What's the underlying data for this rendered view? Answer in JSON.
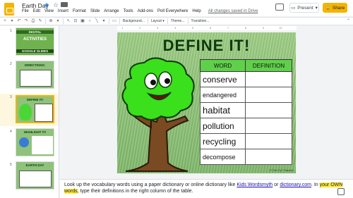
{
  "app": {
    "doc_title": "Earth Day",
    "globe_icon": "globe-icon",
    "saved_status": "All changes saved in Drive",
    "present_label": "Present",
    "share_label": "Share",
    "brand_color": "#f4b400"
  },
  "menu": [
    "File",
    "Edit",
    "View",
    "Insert",
    "Format",
    "Slide",
    "Arrange",
    "Tools",
    "Add-ons",
    "Poll Everywhere",
    "Help"
  ],
  "toolbar": {
    "background_label": "Background...",
    "layout_label": "Layout ▾",
    "theme_label": "Theme...",
    "transition_label": "Transition..."
  },
  "ruler": [
    "1",
    "2",
    "3",
    "4",
    "5",
    "6",
    "7",
    "8",
    "9",
    "10"
  ],
  "slides": [
    {
      "num": "1",
      "caption_1": "DIGITAL",
      "caption_2": "ACTIVITIES",
      "caption_3": "GOOGLE SLIDES"
    },
    {
      "num": "2",
      "caption_1": "DIRECTIONS:"
    },
    {
      "num": "3",
      "caption_1": "DEFINE IT!"
    },
    {
      "num": "4",
      "caption_1": "HIGHLIGHT IT!"
    },
    {
      "num": "5",
      "caption_1": "EARTH DAY"
    }
  ],
  "slide": {
    "title": "DEFINE IT!",
    "col_word": "WORD",
    "col_definition": "DEFINITION",
    "words": [
      "conserve",
      "endangered",
      "habitat",
      "pollution",
      "recycling",
      "decompose"
    ],
    "credit": "© The TpT Teacher"
  },
  "notes": {
    "part1": "Look up the vocabulary words using a paper dictionary or online dictionary like ",
    "link1": "Kids Wordsmyth",
    "part2": " or ",
    "link2": "dictionary.com",
    "part3": ". In ",
    "highlight": "your OWN words",
    "part4": ", type their definitions in the right column of the table."
  }
}
